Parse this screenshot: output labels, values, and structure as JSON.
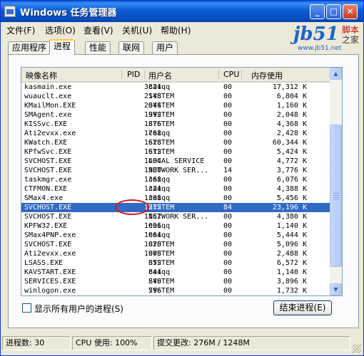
{
  "window": {
    "title": "Windows 任务管理器",
    "controls": {
      "minimize": "_",
      "maximize": "□",
      "close": "✕"
    }
  },
  "menu": [
    "文件(F)",
    "选项(O)",
    "查看(V)",
    "关机(U)",
    "帮助(H)"
  ],
  "watermark": {
    "logo": "jb51",
    "tag1": "脚本",
    "tag2": "之家",
    "url": "www.jb51.net"
  },
  "tabs": [
    "应用程序",
    "进程",
    "性能",
    "联网",
    "用户"
  ],
  "active_tab": "进程",
  "columns": [
    "映像名称",
    "PID",
    "用户名",
    "CPU",
    "内存使用"
  ],
  "processes": [
    {
      "name": "kasmain.exe",
      "pid": "3824",
      "user": "caiqq",
      "cpu": "00",
      "mem": "17,312 K"
    },
    {
      "name": "wuauclt.exe",
      "pid": "2148",
      "user": "SYSTEM",
      "cpu": "00",
      "mem": "6,804 K"
    },
    {
      "name": "KMailMon.EXE",
      "pid": "2044",
      "user": "SYSTEM",
      "cpu": "00",
      "mem": "1,160 K"
    },
    {
      "name": "SMAgent.exe",
      "pid": "1992",
      "user": "SYSTEM",
      "cpu": "00",
      "mem": "2,048 K"
    },
    {
      "name": "KISSvc.EXE",
      "pid": "1876",
      "user": "SYSTEM",
      "cpu": "00",
      "mem": "4,368 K"
    },
    {
      "name": "Ati2evxx.exe",
      "pid": "1768",
      "user": "caiqq",
      "cpu": "00",
      "mem": "2,428 K"
    },
    {
      "name": "KWatch.EXE",
      "pid": "1628",
      "user": "SYSTEM",
      "cpu": "00",
      "mem": "60,344 K"
    },
    {
      "name": "KPfwSvc.EXE",
      "pid": "1612",
      "user": "SYSTEM",
      "cpu": "00",
      "mem": "5,424 K"
    },
    {
      "name": "SVCHOST.EXE",
      "pid": "1484",
      "user": "LOCAL SERVICE",
      "cpu": "00",
      "mem": "4,772 K"
    },
    {
      "name": "SVCHOST.EXE",
      "pid": "1380",
      "user": "NETWORK SER...",
      "cpu": "14",
      "mem": "3,776 K"
    },
    {
      "name": "taskmgr.exe",
      "pid": "1368",
      "user": "caiqq",
      "cpu": "00",
      "mem": "6,076 K"
    },
    {
      "name": "CTFMON.EXE",
      "pid": "1324",
      "user": "caiqq",
      "cpu": "00",
      "mem": "4,388 K"
    },
    {
      "name": "SMax4.exe",
      "pid": "1308",
      "user": "caiqq",
      "cpu": "00",
      "mem": "5,456 K"
    },
    {
      "name": "SVCHOST.EXE",
      "pid": "1212",
      "user": "SYSTEM",
      "cpu": "84",
      "mem": "23,196 K"
    },
    {
      "name": "SVCHOST.EXE",
      "pid": "1152",
      "user": "NETWORK SER...",
      "cpu": "00",
      "mem": "4,380 K"
    },
    {
      "name": "KPFW32.EXE",
      "pid": "1096",
      "user": "caiqq",
      "cpu": "00",
      "mem": "1,140 K"
    },
    {
      "name": "SMax4PNP.exe",
      "pid": "1064",
      "user": "caiqq",
      "cpu": "00",
      "mem": "5,444 K"
    },
    {
      "name": "SVCHOST.EXE",
      "pid": "1020",
      "user": "SYSTEM",
      "cpu": "00",
      "mem": "5,096 K"
    },
    {
      "name": "Ati2evxx.exe",
      "pid": "1008",
      "user": "SYSTEM",
      "cpu": "00",
      "mem": "2,488 K"
    },
    {
      "name": "LSASS.EXE",
      "pid": "852",
      "user": "SYSTEM",
      "cpu": "00",
      "mem": "6,572 K"
    },
    {
      "name": "KAVSTART.EXE",
      "pid": "844",
      "user": "caiqq",
      "cpu": "00",
      "mem": "1,140 K"
    },
    {
      "name": "SERVICES.EXE",
      "pid": "840",
      "user": "SYSTEM",
      "cpu": "00",
      "mem": "3,896 K"
    },
    {
      "name": "winlogon.exe",
      "pid": "796",
      "user": "SYSTEM",
      "cpu": "00",
      "mem": "1,732 K"
    }
  ],
  "selected_pid": "1212",
  "show_all_label": "显示所有用户的进程(S)",
  "end_process_label": "结束进程(E)",
  "status": {
    "processes": "进程数: 30",
    "cpu": "CPU 使用: 100%",
    "commit": "提交更改: 276M / 1248M"
  },
  "colors": {
    "title_bar": "#0A5FD8",
    "selection": "#316AC5",
    "highlight_circle": "#E01010"
  }
}
